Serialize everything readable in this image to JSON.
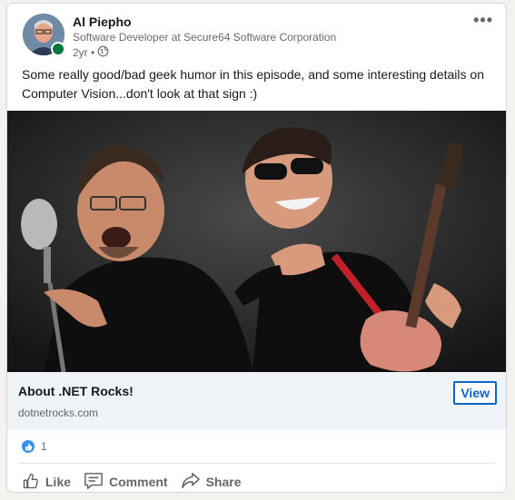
{
  "post": {
    "author_name": "Al Piepho",
    "headline": "Software Developer at Secure64 Software Corporation",
    "time": "2yr •",
    "more_label": "•••",
    "text": "Some really good/bad geek humor in this episode, and some interesting details on Computer Vision...don't look at that sign :)"
  },
  "link": {
    "title": "About .NET Rocks!",
    "domain": "dotnetrocks.com",
    "view_label": "View"
  },
  "social": {
    "reaction_count": "1"
  },
  "actions": {
    "like": "Like",
    "comment": "Comment",
    "share": "Share"
  },
  "colors": {
    "accent": "#0a66c2",
    "presence": "#057642",
    "like_badge": "#378fe9",
    "link_bar": "#eef3f8"
  },
  "icons": {
    "visibility": "globe-icon",
    "reaction": "thumbs-up-icon",
    "like": "like-icon",
    "comment": "comment-icon",
    "share": "share-icon"
  }
}
